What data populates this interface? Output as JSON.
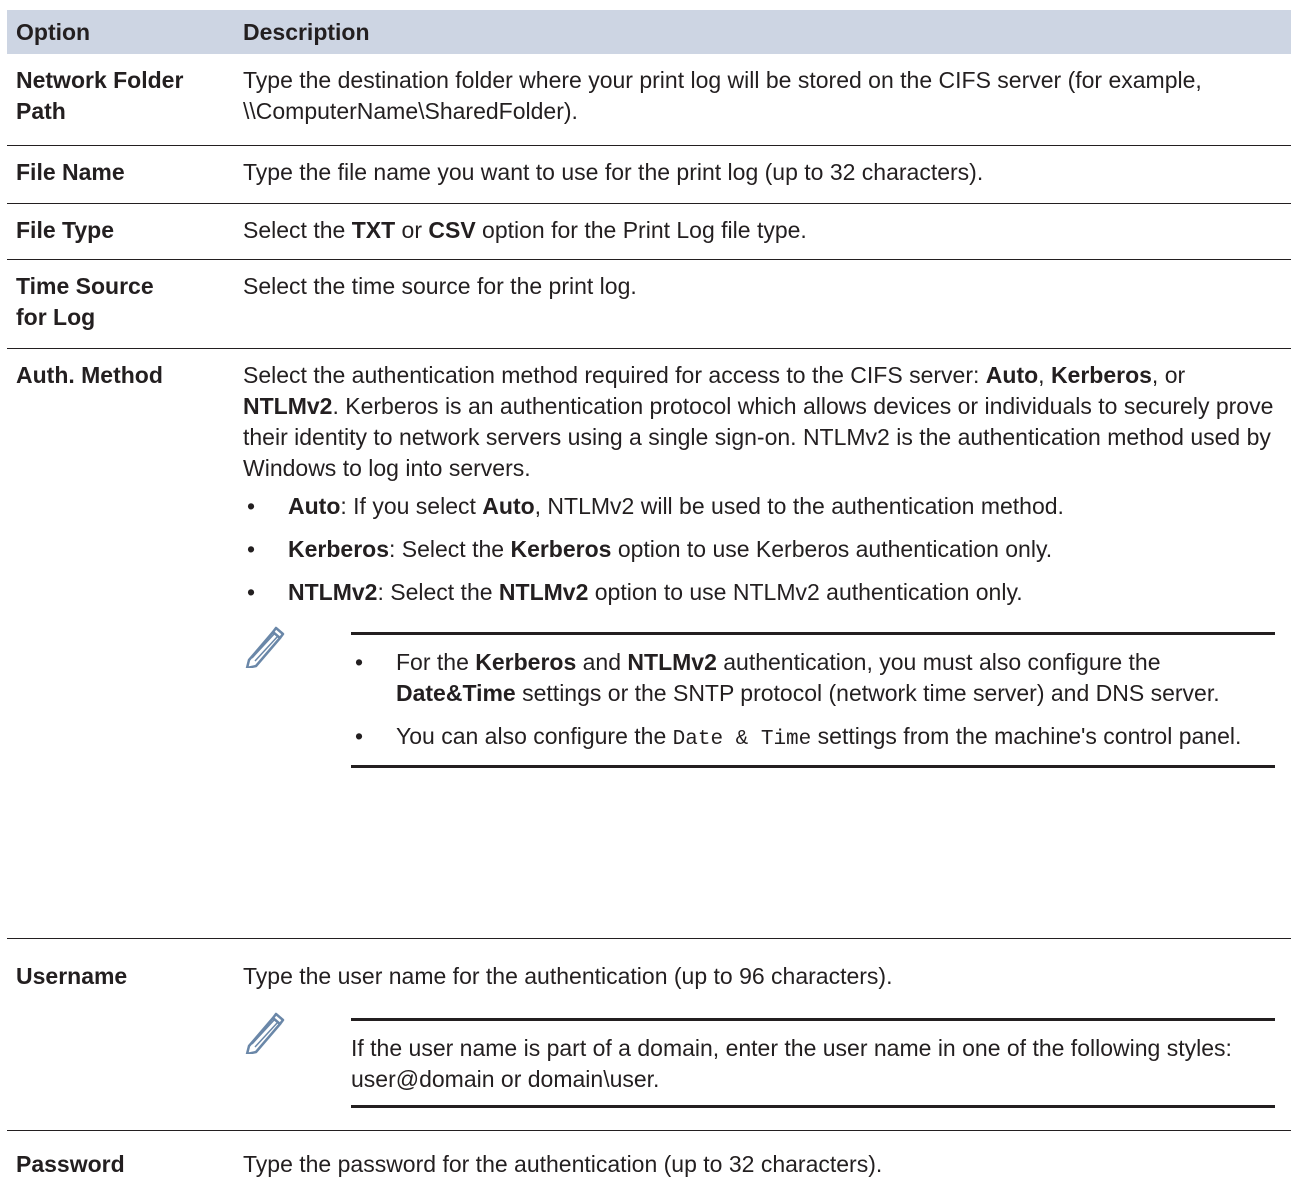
{
  "header": {
    "option": "Option",
    "description": "Description"
  },
  "rows": {
    "network_folder_path": {
      "label_line1": "Network Folder",
      "label_line2": "Path",
      "desc": "Type the destination folder where your print log will be stored on the CIFS server (for example, \\\\ComputerName\\SharedFolder)."
    },
    "file_name": {
      "label": "File Name",
      "desc": "Type the file name you want to use for the print log (up to 32 characters)."
    },
    "file_type": {
      "label": "File Type",
      "pre": "Select the ",
      "b1": "TXT",
      "mid": " or ",
      "b2": "CSV",
      "post": " option for the Print Log file type."
    },
    "time_source": {
      "label_line1": "Time Source",
      "label_line2": "for Log",
      "desc": "Select the time source for the print log."
    },
    "auth_method": {
      "label": "Auth. Method",
      "intro_pre": "Select the authentication method required for access to the CIFS server: ",
      "intro_auto": "Auto",
      "intro_comma": ", ",
      "intro_kerberos": "Kerberos",
      "intro_or": ", or ",
      "intro_ntlm": "NTLMv2",
      "intro_post": ". Kerberos is an authentication protocol which allows devices or individuals to securely prove their identity to network servers using a single sign-on. NTLMv2 is the authentication method used by Windows to log into servers.",
      "bullets": {
        "auto": {
          "term": "Auto",
          "t1": ": If you select ",
          "b": "Auto",
          "t2": ", NTLMv2 will be used to the authentication method."
        },
        "kerberos": {
          "term": "Kerberos",
          "t1": ": Select the ",
          "b": "Kerberos",
          "t2": " option to use Kerberos authentication only."
        },
        "ntlm": {
          "term": "NTLMv2",
          "t1": ": Select the ",
          "b": "NTLMv2",
          "t2": " option to use NTLMv2 authentication only."
        }
      },
      "note": {
        "n1_pre": "For the ",
        "n1_b1": "Kerberos",
        "n1_and": " and ",
        "n1_b2": "NTLMv2",
        "n1_mid": " authentication, you must also configure the ",
        "n1_b3": "Date&Time",
        "n1_post": " settings or the SNTP protocol (network time server) and DNS server.",
        "n2_pre": "You can also configure the ",
        "n2_mono": "Date & Time",
        "n2_post": " settings from the machine's control panel."
      }
    },
    "username": {
      "label": "Username",
      "desc": "Type the user name for the authentication (up to 96 characters).",
      "note": "If the user name is part of a domain, enter the user name in one of the following styles: user@domain or domain\\user."
    },
    "password": {
      "label": "Password",
      "desc": "Type the password for the authentication (up to 32 characters)."
    }
  },
  "bullet_char": "•",
  "icons": {
    "note": "pencil-note-icon"
  },
  "colors": {
    "header_bg": "#cdd5e3",
    "text": "#231f20"
  }
}
